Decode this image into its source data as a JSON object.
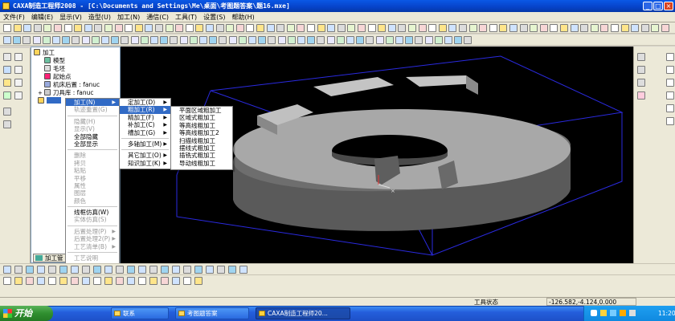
{
  "window": {
    "title": "CAXA制造工程师2008 - [C:\\Documents and Settings\\Me\\桌面\\考图题答案\\题16.mxe]"
  },
  "menubar": {
    "items": [
      "文件(F)",
      "编辑(E)",
      "显示(V)",
      "造型(U)",
      "加工(N)",
      "通信(C)",
      "工具(T)",
      "设置(S)",
      "帮助(H)"
    ]
  },
  "tree": {
    "root": "加工",
    "items": [
      "模型",
      "毛坯",
      "起始点",
      "机床后置 : fanuc",
      "刀具库 : fanuc"
    ],
    "tab_label": "加工管"
  },
  "context_menu": {
    "items": [
      {
        "label": "加工(N)",
        "state": "highlight",
        "submenu": true
      },
      {
        "label": "轨迹重置(G)",
        "state": "disabled"
      },
      {
        "separator": true
      },
      {
        "label": "隐藏(H)",
        "state": "disabled"
      },
      {
        "label": "显示(V)",
        "state": "disabled"
      },
      {
        "label": "全部隐藏",
        "state": "normal"
      },
      {
        "label": "全部显示",
        "state": "normal"
      },
      {
        "separator": true
      },
      {
        "label": "删除",
        "state": "disabled"
      },
      {
        "label": "拷贝",
        "state": "disabled"
      },
      {
        "label": "粘贴",
        "state": "disabled"
      },
      {
        "label": "平移",
        "state": "disabled"
      },
      {
        "label": "属性",
        "state": "disabled"
      },
      {
        "label": "图层",
        "state": "disabled"
      },
      {
        "label": "颜色",
        "state": "disabled"
      },
      {
        "separator": true
      },
      {
        "label": "线框仿真(W)",
        "state": "normal"
      },
      {
        "label": "实体仿真(S)",
        "state": "disabled"
      },
      {
        "separator": true
      },
      {
        "label": "后置处理(P)",
        "state": "disabled",
        "submenu": true
      },
      {
        "label": "后置处理2(P)",
        "state": "disabled",
        "submenu": true
      },
      {
        "label": "工艺清单(B)",
        "state": "disabled",
        "submenu": true
      },
      {
        "separator": true
      },
      {
        "label": "工艺说明",
        "state": "disabled"
      }
    ]
  },
  "submenu_machining": {
    "items": [
      {
        "label": "定加工(D)",
        "state": "normal",
        "submenu": true
      },
      {
        "label": "粗加工(R)",
        "state": "highlight",
        "submenu": true
      },
      {
        "label": "精加工(F)",
        "state": "normal",
        "submenu": true
      },
      {
        "label": "补加工(C)",
        "state": "normal",
        "submenu": true
      },
      {
        "label": "槽加工(G)",
        "state": "normal",
        "submenu": true
      },
      {
        "separator": true
      },
      {
        "label": "多轴加工(M)",
        "state": "normal",
        "submenu": true
      },
      {
        "separator": true
      },
      {
        "label": "其它加工(O)",
        "state": "normal",
        "submenu": true
      },
      {
        "label": "知识加工(K)",
        "state": "normal",
        "submenu": true
      }
    ]
  },
  "submenu_roughing": {
    "items": [
      "平面区域粗加工",
      "区域式粗加工",
      "等高线粗加工",
      "等高线粗加工2",
      "扫描线粗加工",
      "摆线式粗加工",
      "插铣式粗加工",
      "导动线粗加工"
    ]
  },
  "status": {
    "label": "工具状态",
    "coordinates": "-126.582,-4.124,0.000"
  },
  "taskbar": {
    "start_label": "开始",
    "tasks": [
      "联系",
      "考图题答案",
      "CAXA制造工程师20..."
    ],
    "clock": "11:20"
  },
  "colors": {
    "highlight": "#316ac5",
    "viewport_bg": "#000000",
    "bbox_line": "#2a2ae0",
    "part_gray": "#9a9a9a"
  }
}
